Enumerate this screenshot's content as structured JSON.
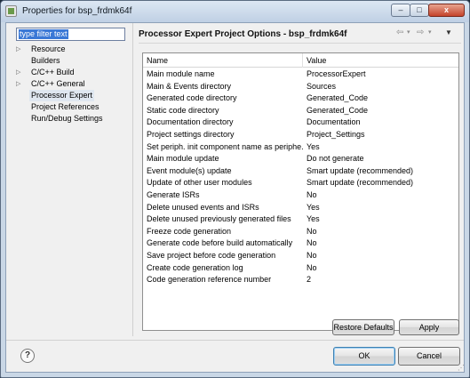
{
  "window": {
    "title": "Properties for bsp_frdmk64f",
    "controls": {
      "minimize": "–",
      "maximize": "□",
      "close": "x"
    }
  },
  "filter": {
    "value": "type filter text"
  },
  "tree": {
    "items": [
      {
        "label": "Resource",
        "expandable": true
      },
      {
        "label": "Builders",
        "expandable": false
      },
      {
        "label": "C/C++ Build",
        "expandable": true
      },
      {
        "label": "C/C++ General",
        "expandable": true
      },
      {
        "label": "Processor Expert",
        "expandable": false,
        "selected": true
      },
      {
        "label": "Project References",
        "expandable": false
      },
      {
        "label": "Run/Debug Settings",
        "expandable": false
      }
    ]
  },
  "page": {
    "title": "Processor Expert Project Options - bsp_frdmk64f",
    "nav": {
      "back": "⇦",
      "forward": "⇨",
      "dropdown": "▾",
      "menu": "▼"
    }
  },
  "table": {
    "headers": {
      "name": "Name",
      "value": "Value"
    },
    "rows": [
      {
        "name": "Main module name",
        "value": "ProcessorExpert"
      },
      {
        "name": "Main & Events directory",
        "value": "Sources"
      },
      {
        "name": "Generated code directory",
        "value": "Generated_Code"
      },
      {
        "name": "Static code directory",
        "value": "Generated_Code"
      },
      {
        "name": "Documentation directory",
        "value": "Documentation"
      },
      {
        "name": "Project settings directory",
        "value": "Project_Settings"
      },
      {
        "name": "Set periph. init component name as periphe...",
        "value": "Yes"
      },
      {
        "name": "Main module update",
        "value": "Do not generate"
      },
      {
        "name": "Event module(s) update",
        "value": "Smart update (recommended)"
      },
      {
        "name": "Update of other user modules",
        "value": "Smart update (recommended)"
      },
      {
        "name": "Generate ISRs",
        "value": "No"
      },
      {
        "name": "Delete unused events and ISRs",
        "value": "Yes"
      },
      {
        "name": "Delete unused previously generated files",
        "value": "Yes"
      },
      {
        "name": "Freeze code generation",
        "value": "No"
      },
      {
        "name": "Generate code before build automatically",
        "value": "No"
      },
      {
        "name": "Save project before code generation",
        "value": "No"
      },
      {
        "name": "Create code generation log",
        "value": "No"
      },
      {
        "name": "Code generation reference number",
        "value": "2"
      }
    ]
  },
  "buttons": {
    "restore_defaults": "Restore Defaults",
    "apply": "Apply",
    "ok": "OK",
    "cancel": "Cancel",
    "help": "?"
  }
}
